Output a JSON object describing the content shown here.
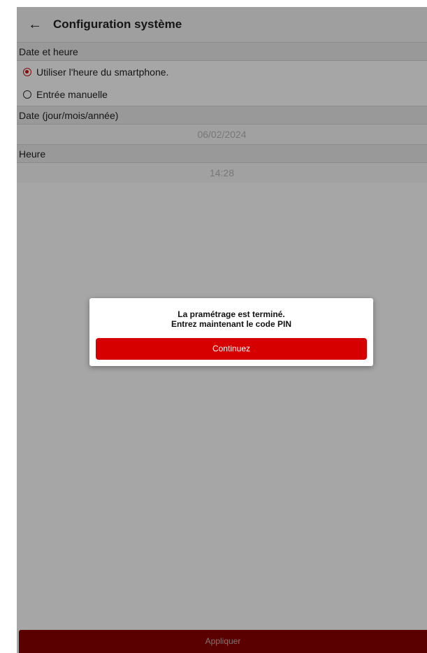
{
  "header": {
    "back_icon": "arrow-left-icon",
    "title": "Configuration système"
  },
  "date_time_section": {
    "header": "Date et heure",
    "options": [
      {
        "label": "Utiliser l'heure du smartphone.",
        "selected": true
      },
      {
        "label": "Entrée manuelle",
        "selected": false
      }
    ]
  },
  "date_section": {
    "header": "Date (jour/mois/année)",
    "value": "06/02/2024"
  },
  "time_section": {
    "header": "Heure",
    "value": "14:28"
  },
  "apply_button": {
    "label": "Appliquer"
  },
  "dialog": {
    "line1": "La pramétrage est terminé.",
    "line2": "Entrez maintenant le code PIN",
    "button": "Continuez"
  },
  "colors": {
    "accent": "#d60000",
    "apply_dimmed": "#8a0000"
  }
}
